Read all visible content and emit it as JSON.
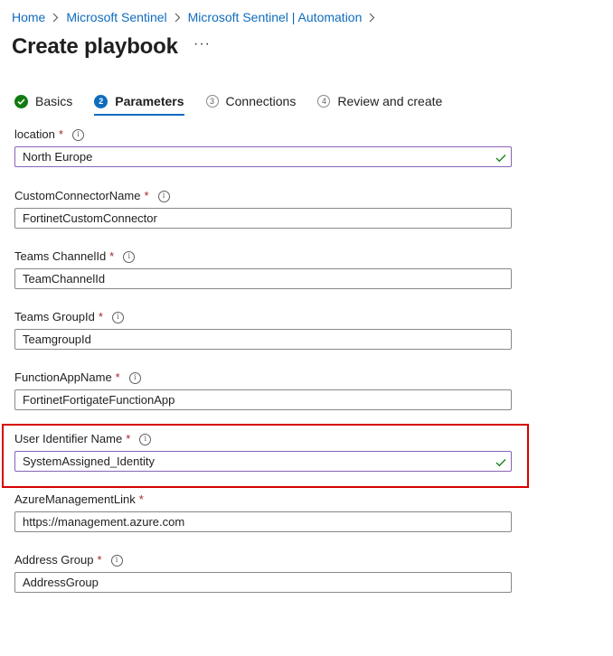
{
  "breadcrumb": {
    "items": [
      "Home",
      "Microsoft Sentinel",
      "Microsoft Sentinel | Automation"
    ]
  },
  "page": {
    "title": "Create playbook",
    "more_label": "···"
  },
  "tabs": [
    {
      "label": "Basics",
      "step": "✓",
      "state": "done"
    },
    {
      "label": "Parameters",
      "step": "2",
      "state": "active"
    },
    {
      "label": "Connections",
      "step": "3",
      "state": "pending"
    },
    {
      "label": "Review and create",
      "step": "4",
      "state": "pending"
    }
  ],
  "fields": [
    {
      "label": "location",
      "value": "North Europe",
      "required": "*",
      "info": "i",
      "validated": true
    },
    {
      "label": "CustomConnectorName",
      "value": "FortinetCustomConnector",
      "required": "*",
      "info": "i",
      "validated": false
    },
    {
      "label": "Teams ChannelId",
      "value": "TeamChannelId",
      "required": "*",
      "info": "i",
      "validated": false
    },
    {
      "label": "Teams GroupId",
      "value": "TeamgroupId",
      "required": "*",
      "info": "i",
      "validated": false
    },
    {
      "label": "FunctionAppName",
      "value": "FortinetFortigateFunctionApp",
      "required": "*",
      "info": "i",
      "validated": false
    },
    {
      "label": "User Identifier Name",
      "value": "SystemAssigned_Identity",
      "required": "*",
      "info": "i",
      "validated": true
    },
    {
      "label": "AzureManagementLink",
      "value": "https://management.azure.com",
      "required": "*",
      "info": "",
      "validated": false
    },
    {
      "label": "Address Group",
      "value": "AddressGroup",
      "required": "*",
      "info": "i",
      "validated": false
    }
  ],
  "colors": {
    "link": "#0f6cbd",
    "required": "#a4262c",
    "success": "#107c10",
    "highlight": "#d70000",
    "valid_border": "#8764b8"
  }
}
